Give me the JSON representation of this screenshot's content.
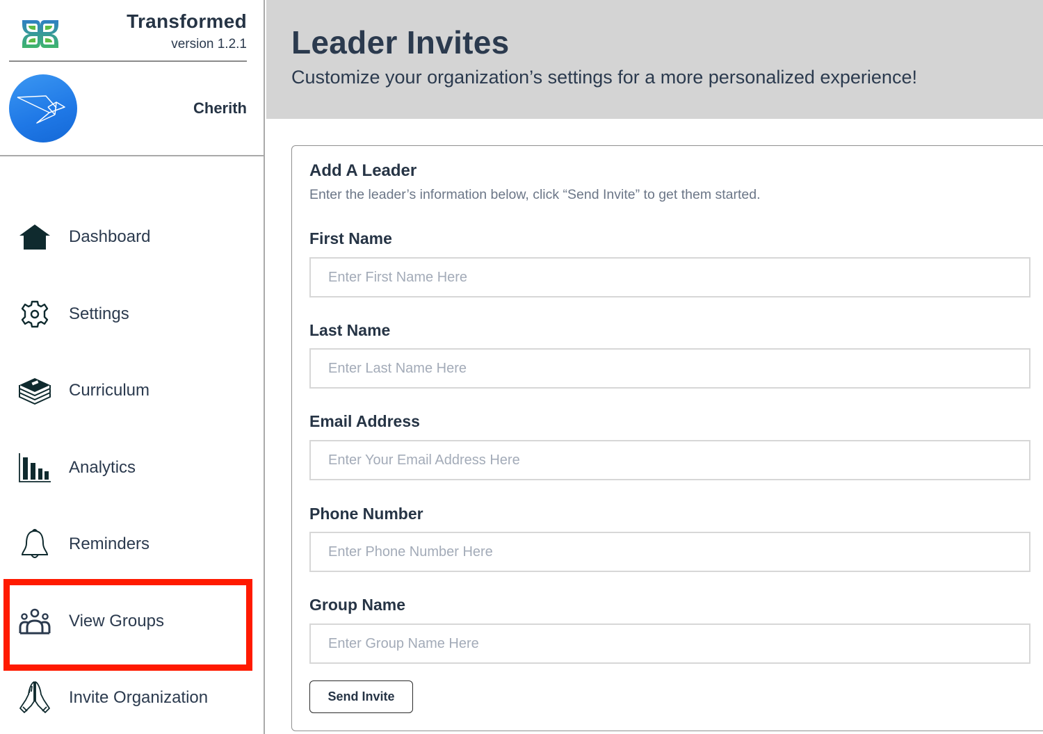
{
  "brand": {
    "name": "Transformed",
    "version": "version 1.2.1",
    "logo_colors": {
      "outer_gradient_top": "#2f7fc4",
      "outer_gradient_bottom": "#3fb56c",
      "leaf": "#5dbb46"
    }
  },
  "user": {
    "name": "Cherith",
    "avatar_icon": "origami-bird-icon",
    "avatar_color": "#1f78e6"
  },
  "sidebar": {
    "items": [
      {
        "label": "Dashboard",
        "icon": "home-icon"
      },
      {
        "label": "Settings",
        "icon": "gear-icon"
      },
      {
        "label": "Curriculum",
        "icon": "books-icon"
      },
      {
        "label": "Analytics",
        "icon": "bar-chart-icon"
      },
      {
        "label": "Reminders",
        "icon": "bell-icon"
      },
      {
        "label": "View Groups",
        "icon": "group-icon",
        "highlighted": true
      },
      {
        "label": "Invite Organization",
        "icon": "praying-hands-icon"
      }
    ],
    "highlight_color": "#ff1a00"
  },
  "header": {
    "title": "Leader Invites",
    "subtitle": "Customize your organization’s settings for a more personalized experience!"
  },
  "card": {
    "title": "Add A Leader",
    "description": "Enter the leader’s information below, click “Send Invite” to get them started.",
    "fields": [
      {
        "label": "First Name",
        "placeholder": "Enter First Name Here",
        "value": ""
      },
      {
        "label": "Last Name",
        "placeholder": "Enter Last Name Here",
        "value": ""
      },
      {
        "label": "Email Address",
        "placeholder": "Enter Your Email Address Here",
        "value": ""
      },
      {
        "label": "Phone Number",
        "placeholder": "Enter Phone Number Here",
        "value": ""
      },
      {
        "label": "Group Name",
        "placeholder": "Enter Group Name Here",
        "value": ""
      }
    ],
    "submit_label": "Send Invite"
  }
}
